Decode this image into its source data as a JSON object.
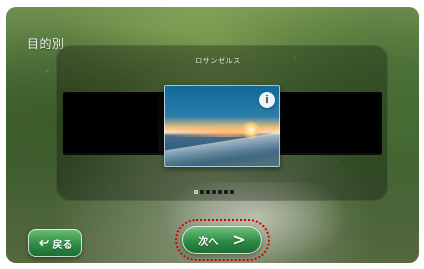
{
  "screen": {
    "title": "目的別",
    "spot_name": "ロサンゼルス"
  },
  "carousel": {
    "info_label": "i",
    "page_indicator": {
      "active_index": 0,
      "count": 7
    }
  },
  "footer": {
    "back_label": "戻る",
    "next_label": "次へ",
    "next_chevron": ">"
  },
  "colors": {
    "primary_green": "#2f8b45",
    "focus_ring_red": "#d60000"
  },
  "icons": {
    "back": "back-arrow-icon",
    "info": "info-icon",
    "next": "chevron-right-icon"
  }
}
